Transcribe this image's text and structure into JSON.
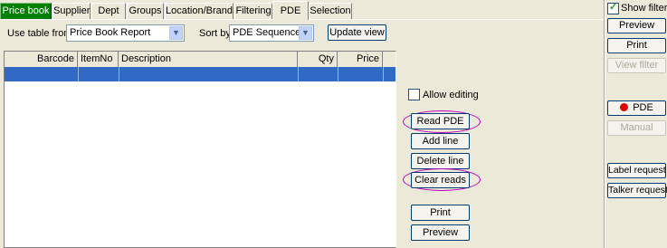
{
  "tabs": [
    "Price book",
    "Supplier",
    "Dept",
    "Groups",
    "Location/Brand",
    "Filtering",
    "PDE",
    "Selection"
  ],
  "toolbar": {
    "use_table_label": "Use table from",
    "use_table_value": "Price Book Report",
    "sort_by_label": "Sort by",
    "sort_by_value": "PDE Sequence",
    "update_view": "Update view"
  },
  "grid": {
    "columns": [
      "Barcode",
      "ItemNo",
      "Description",
      "Qty",
      "Price"
    ]
  },
  "pde_panel": {
    "allow_editing": "Allow editing",
    "read_pde": "Read PDE",
    "add_line": "Add line",
    "delete_line": "Delete line",
    "clear_reads": "Clear reads",
    "print": "Print",
    "preview": "Preview"
  },
  "right_panel": {
    "show_filter": "Show filter",
    "preview": "Preview",
    "print": "Print",
    "view_filter": "View filter",
    "pde": "PDE",
    "manual": "Manual",
    "label_request": "Label request",
    "talker_request": "Talker request"
  }
}
